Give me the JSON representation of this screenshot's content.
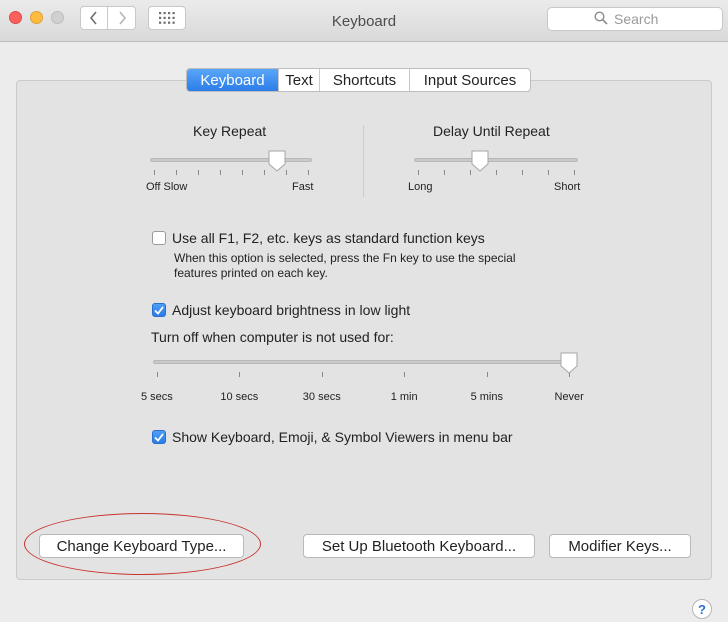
{
  "window": {
    "title": "Keyboard",
    "search_placeholder": "Search",
    "back_symbol": "‹",
    "forward_symbol": "›"
  },
  "tabs": [
    {
      "label": "Keyboard",
      "selected": true
    },
    {
      "label": "Text",
      "selected": false
    },
    {
      "label": "Shortcuts",
      "selected": false
    },
    {
      "label": "Input Sources",
      "selected": false
    }
  ],
  "key_repeat": {
    "title": "Key Repeat",
    "min_label": "Off Slow",
    "max_label": "Fast",
    "value_fraction": 0.8
  },
  "delay_until_repeat": {
    "title": "Delay Until Repeat",
    "min_label": "Long",
    "max_label": "Short",
    "value_fraction": 0.4
  },
  "function_keys": {
    "checked": false,
    "label": "Use all F1, F2, etc. keys as standard function keys",
    "help_line1": "When this option is selected, press the Fn key to use the special",
    "help_line2": "features printed on each key."
  },
  "brightness": {
    "checked": true,
    "label": "Adjust keyboard brightness in low light"
  },
  "turn_off": {
    "label": "Turn off when computer is not used for:",
    "stops": [
      "5 secs",
      "10 secs",
      "30 secs",
      "1 min",
      "5 mins",
      "Never"
    ],
    "selected": "Never"
  },
  "viewers": {
    "checked": true,
    "label": "Show Keyboard, Emoji, & Symbol Viewers in menu bar"
  },
  "buttons": {
    "change_type": "Change Keyboard Type...",
    "bluetooth": "Set Up Bluetooth Keyboard...",
    "modifier": "Modifier Keys..."
  },
  "help_symbol": "?",
  "colors": {
    "accent": "#2c7de8",
    "annotation": "#c8332f"
  }
}
